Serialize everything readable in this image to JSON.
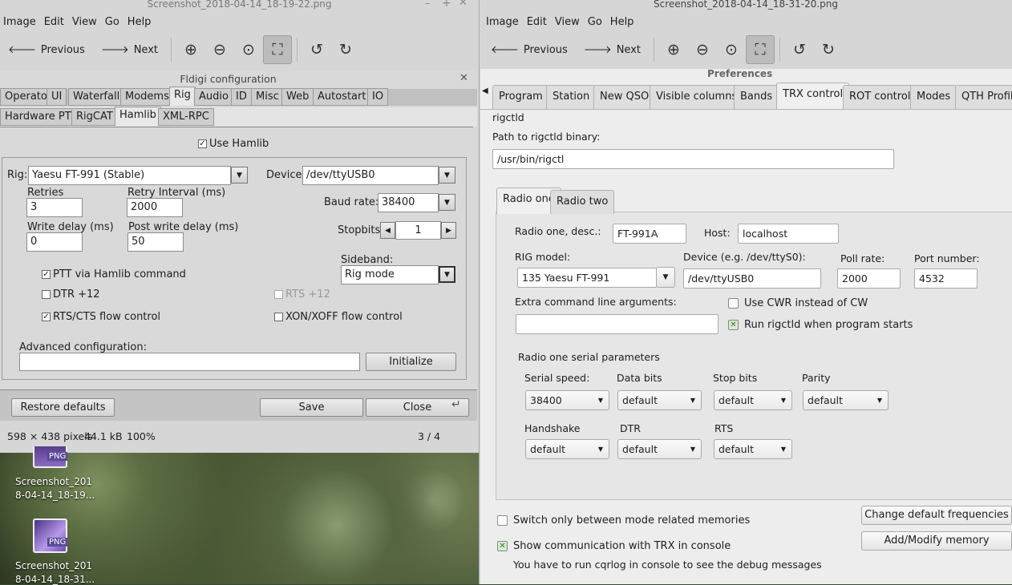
{
  "left_viewer": {
    "title": "Screenshot_2018-04-14_18-19-22.png",
    "menu": [
      "Image",
      "Edit",
      "View",
      "Go",
      "Help"
    ],
    "toolbar": {
      "previous": "Previous",
      "next": "Next"
    },
    "status": {
      "dims": "598 × 438 pixels",
      "size": "44.1 kB",
      "zoom": "100%",
      "index": "3 / 4"
    }
  },
  "fldigi": {
    "title": "Fldigi configuration",
    "tabs": [
      "Operator",
      "UI",
      "Waterfall",
      "Modems",
      "Rig",
      "Audio",
      "ID",
      "Misc",
      "Web",
      "Autostart",
      "IO"
    ],
    "subtabs": [
      "Hardware PTT",
      "RigCAT",
      "Hamlib",
      "XML-RPC"
    ],
    "use_hamlib": "Use Hamlib",
    "rig_label": "Rig:",
    "rig_value": "Yaesu FT-991  (Stable)",
    "device_label": "Device:",
    "device_value": "/dev/ttyUSB0",
    "retries_label": "Retries",
    "retries_value": "3",
    "retry_interval_label": "Retry Interval (ms)",
    "retry_interval_value": "2000",
    "baud_label": "Baud rate:",
    "baud_value": "38400",
    "write_delay_label": "Write delay (ms)",
    "write_delay_value": "0",
    "post_write_label": "Post write delay (ms)",
    "post_write_value": "50",
    "stopbits_label": "Stopbits",
    "stopbits_value": "1",
    "sideband_label": "Sideband:",
    "sideband_value": "Rig mode",
    "ptt_hamlib": "PTT via Hamlib command",
    "dtr": "DTR +12",
    "rts": "RTS +12",
    "rtscts": "RTS/CTS flow control",
    "xonxoff": "XON/XOFF flow control",
    "advanced_label": "Advanced configuration:",
    "initialize": "Initialize",
    "restore": "Restore defaults",
    "save": "Save",
    "close": "Close"
  },
  "desktop_icons": [
    {
      "name1": "Screenshot_201",
      "name2": "8-04-14_18-19...",
      "badge": "PNG"
    },
    {
      "name1": "Screenshot_201",
      "name2": "8-04-14_18-31...",
      "badge": "PNG"
    }
  ],
  "right_viewer": {
    "title": "Screenshot_2018-04-14_18-31-20.png",
    "menu": [
      "Image",
      "Edit",
      "View",
      "Go",
      "Help"
    ],
    "toolbar": {
      "previous": "Previous",
      "next": "Next"
    }
  },
  "prefs": {
    "title": "Preferences",
    "tabs": [
      "Program",
      "Station",
      "New QSO",
      "Visible columns",
      "Bands",
      "TRX control",
      "ROT control",
      "Modes",
      "QTH Profile"
    ],
    "section": "rigctld",
    "path_label": "Path to rigctld binary:",
    "path_value": "/usr/bin/rigctl",
    "radio_tabs": [
      "Radio one",
      "Radio two"
    ],
    "desc_label": "Radio one, desc.:",
    "desc_value": "FT-991A",
    "host_label": "Host:",
    "host_value": "localhost",
    "rig_model_label": "RIG model:",
    "rig_model_value": "135 Yaesu FT-991",
    "device_label": "Device (e.g. /dev/ttyS0):",
    "device_value": "/dev/ttyUSB0",
    "poll_label": "Poll rate:",
    "poll_value": "2000",
    "port_label": "Port number:",
    "port_value": "4532",
    "extra_label": "Extra command line arguments:",
    "cwr": "Use CWR instead of CW",
    "run_rigctld": "Run rigctld when program starts",
    "serial_title": "Radio one serial parameters",
    "serial": {
      "speed_label": "Serial speed:",
      "speed": "38400",
      "databits_label": "Data bits",
      "databits": "default",
      "stopbits_label": "Stop bits",
      "stopbits": "default",
      "parity_label": "Parity",
      "parity": "default",
      "handshake_label": "Handshake",
      "handshake": "default",
      "dtr_label": "DTR",
      "dtr": "default",
      "rts_label": "RTS",
      "rts": "default"
    },
    "switch_mode": "Switch only between mode related memories",
    "show_comm": "Show communication with TRX in console",
    "debug_note": "You have to run cqrlog in console to see the debug messages",
    "change_freq": "Change default frequencies",
    "add_memory": "Add/Modify memory"
  }
}
